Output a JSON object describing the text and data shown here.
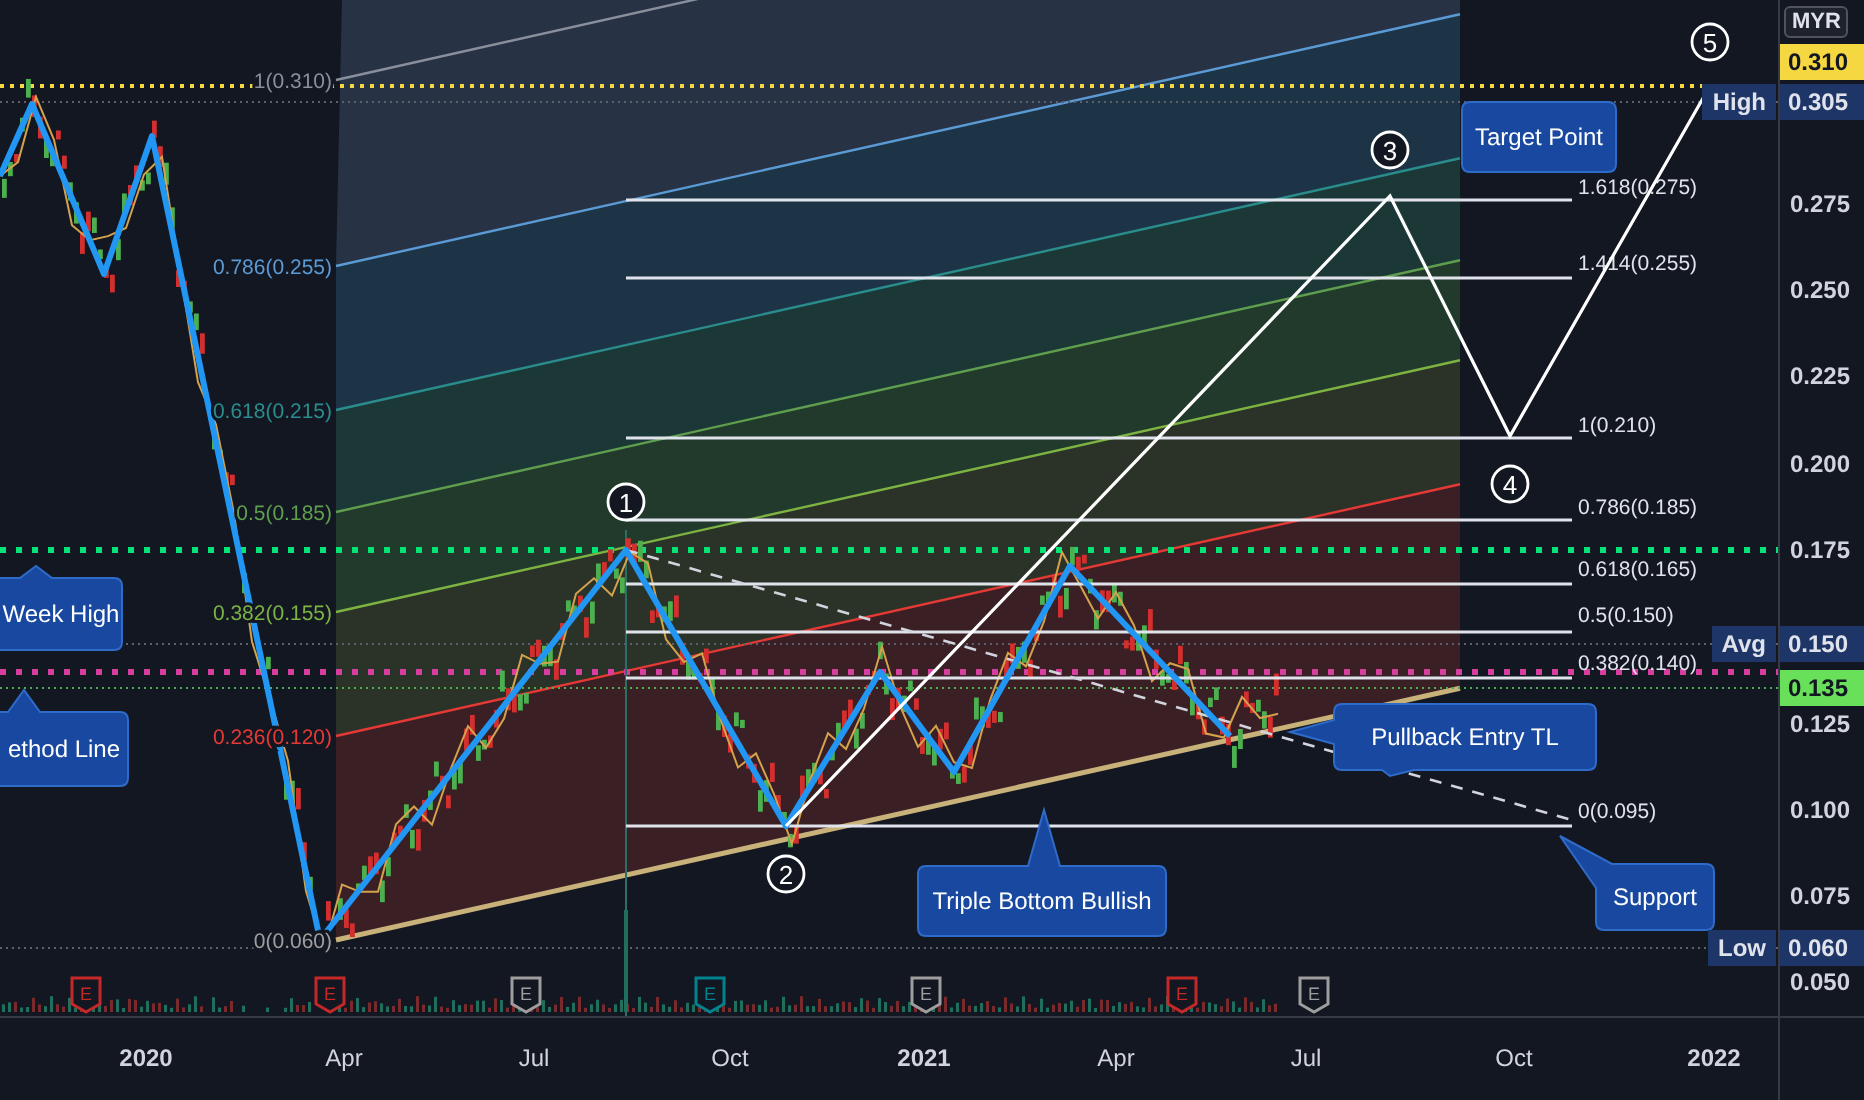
{
  "price_axis": {
    "currency": "MYR",
    "ticks": [
      "0.275",
      "0.250",
      "0.225",
      "0.200",
      "0.175",
      "0.125",
      "0.100",
      "0.075",
      "0.050"
    ],
    "tags": [
      {
        "kind": "prev_high",
        "value": "0.310"
      },
      {
        "kind": "high",
        "label": "High",
        "value": "0.305"
      },
      {
        "kind": "avg",
        "label": "Avg",
        "value": "0.150"
      },
      {
        "kind": "last",
        "value": "0.135"
      },
      {
        "kind": "low",
        "label": "Low",
        "value": "0.060"
      }
    ]
  },
  "time_axis": [
    {
      "text": "2020",
      "kind": "year"
    },
    {
      "text": "Apr",
      "kind": "month"
    },
    {
      "text": "Jul",
      "kind": "month"
    },
    {
      "text": "Oct",
      "kind": "month"
    },
    {
      "text": "2021",
      "kind": "year"
    },
    {
      "text": "Apr",
      "kind": "month"
    },
    {
      "text": "Jul",
      "kind": "month"
    },
    {
      "text": "Oct",
      "kind": "month"
    },
    {
      "text": "2022",
      "kind": "year"
    }
  ],
  "fib_fan_levels": [
    {
      "label": "1(0.310)",
      "color": "#8a8f9c"
    },
    {
      "label": "0.786(0.255)",
      "color": "#5b9bd5"
    },
    {
      "label": "0.618(0.215)",
      "color": "#2a8c8c"
    },
    {
      "label": "0.5(0.185)",
      "color": "#5f9e4f"
    },
    {
      "label": "0.382(0.155)",
      "color": "#7cb342"
    },
    {
      "label": "0.236(0.120)",
      "color": "#e53935"
    },
    {
      "label": "0(0.060)",
      "color": "#9e9e9e"
    }
  ],
  "fib_extension_levels": [
    "1.618(0.275)",
    "1.414(0.255)",
    "1(0.210)",
    "0.786(0.185)",
    "0.618(0.165)",
    "0.5(0.150)",
    "0.382(0.140)",
    "0(0.095)"
  ],
  "wave_points": [
    "1",
    "2",
    "3",
    "4",
    "5"
  ],
  "callouts": [
    "Week High",
    "ethod Line",
    "Target Point",
    "Triple Bottom Bullish",
    "Pullback Entry TL",
    "Support"
  ],
  "earnings_markers": [
    {
      "letter": "E",
      "color": "#c62828"
    },
    {
      "letter": "E",
      "color": "#c62828"
    },
    {
      "letter": "E",
      "color": "#9e9e9e"
    },
    {
      "letter": "E",
      "color": "#00838f"
    },
    {
      "letter": "E",
      "color": "#9e9e9e"
    },
    {
      "letter": "E",
      "color": "#c62828"
    },
    {
      "letter": "E",
      "color": "#9e9e9e"
    }
  ]
}
